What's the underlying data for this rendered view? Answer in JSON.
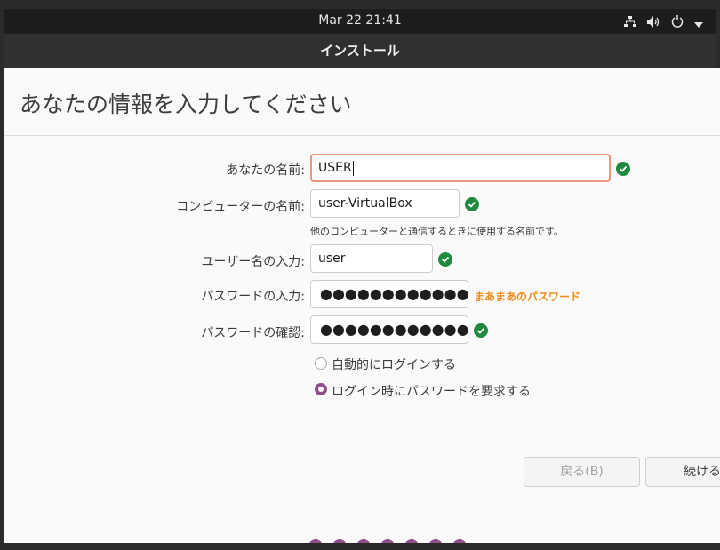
{
  "topbar": {
    "clock": "Mar 22  21:41"
  },
  "window": {
    "title": "インストール"
  },
  "page": {
    "heading": "あなたの情報を入力してください"
  },
  "form": {
    "name_label": "あなたの名前:",
    "name_value": "USER",
    "computer_label": "コンピューターの名前:",
    "computer_value": "user-VirtualBox",
    "computer_hint": "他のコンピューターと通信するときに使用する名前です。",
    "username_label": "ユーザー名の入力:",
    "username_value": "user",
    "password_label": "パスワードの入力:",
    "password_value": "●●●●●●●●●●●●●",
    "password_strength": "まあまあのパスワード",
    "confirm_label": "パスワードの確認:",
    "confirm_value": "●●●●●●●●●●●●●"
  },
  "options": {
    "auto_login": "自動的にログインする",
    "require_password": "ログイン時にパスワードを要求する",
    "selected": "require_password"
  },
  "buttons": {
    "back": "戻る(B)",
    "continue": "続ける"
  },
  "colors": {
    "accent": "#924d8b",
    "ok": "#1f8a3e",
    "warning": "#f18b1d",
    "focus": "#e9967a"
  },
  "icons": [
    "network-icon",
    "volume-icon",
    "power-icon",
    "chevron-down-icon",
    "check-icon"
  ]
}
